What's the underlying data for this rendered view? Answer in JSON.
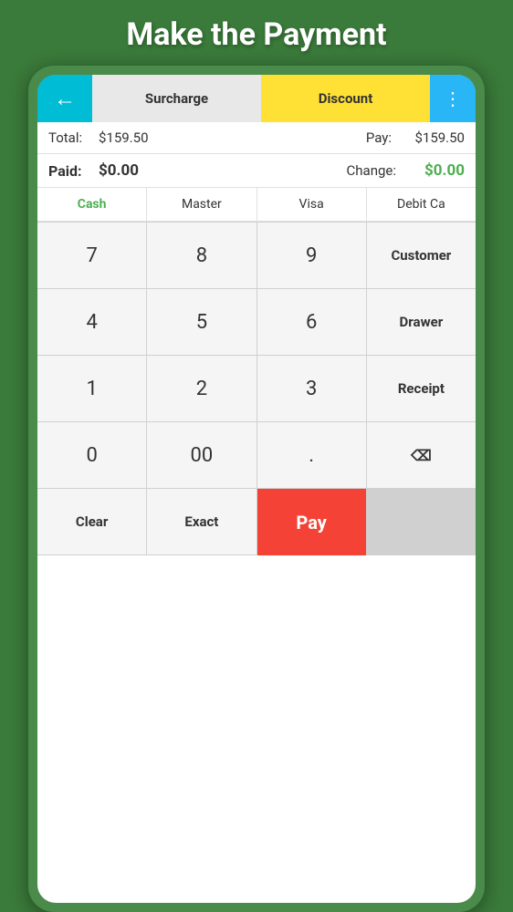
{
  "header": {
    "title": "Make the Payment"
  },
  "topbar": {
    "back_label": "←",
    "surcharge_label": "Surcharge",
    "discount_label": "Discount",
    "menu_label": "⋮"
  },
  "info": {
    "total_label": "Total:",
    "total_value": "$159.50",
    "pay_label": "Pay:",
    "pay_value": "$159.50",
    "paid_label": "Paid:",
    "paid_value": "$0.00",
    "change_label": "Change:",
    "change_value": "$0.00"
  },
  "payment_methods": [
    {
      "label": "Cash",
      "active": true
    },
    {
      "label": "Master",
      "active": false
    },
    {
      "label": "Visa",
      "active": false
    },
    {
      "label": "Debit Ca",
      "active": false
    }
  ],
  "keypad": {
    "rows": [
      [
        "7",
        "8",
        "9",
        "Customer"
      ],
      [
        "4",
        "5",
        "6",
        "Drawer"
      ],
      [
        "1",
        "2",
        "3",
        "Receipt"
      ],
      [
        "0",
        "00",
        ".",
        "Pay"
      ],
      [
        "⌫",
        "Clear",
        "Exact",
        ""
      ]
    ]
  },
  "colors": {
    "green_bg": "#3a7a3a",
    "teal": "#00BCD4",
    "yellow": "#FFE135",
    "light_blue": "#29B6F6",
    "red": "#f44336",
    "cash_green": "#4CAF50",
    "change_green": "#4CAF50"
  }
}
